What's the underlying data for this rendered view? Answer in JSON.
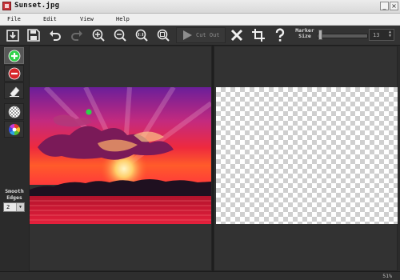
{
  "window": {
    "title": "Sunset.jpg"
  },
  "menu": [
    {
      "label": "File"
    },
    {
      "label": "Edit"
    },
    {
      "label": "View"
    },
    {
      "label": "Help"
    }
  ],
  "toolbar": {
    "cut_out_label": "Cut Out",
    "marker_size_label": "Marker Size",
    "marker_size_value": "13"
  },
  "sidebar": {
    "smooth_edges_label": "Smooth Edges",
    "smooth_edges_value": "2"
  },
  "status": {
    "zoom": "51%"
  },
  "colors": {
    "background": "#2b2b2b",
    "marker_green": "#2fd14a",
    "remove_red": "#d7262b"
  }
}
